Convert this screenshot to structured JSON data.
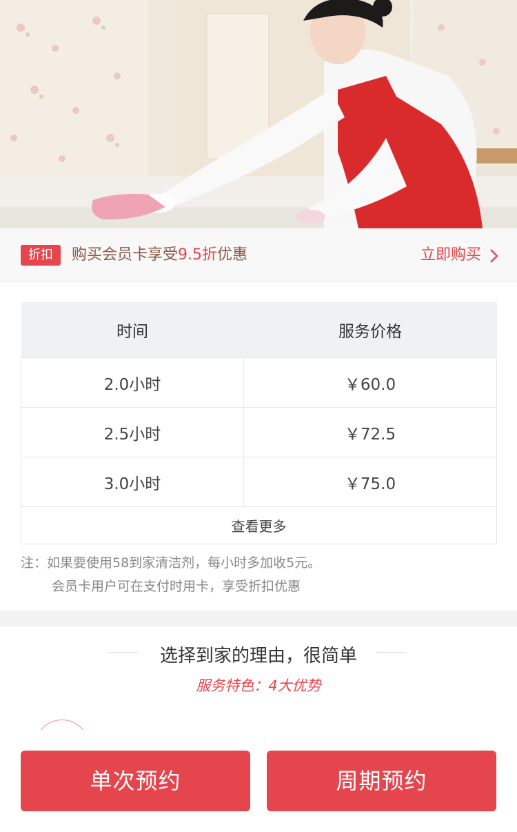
{
  "hero": {
    "image": "woman-cleaning-table-photo"
  },
  "promo": {
    "badge": "折扣",
    "text_before": "购买会员卡享受",
    "text_highlight": "9.5折",
    "text_after": "优惠",
    "link": "立即购买",
    "link_icon": "chevron-right-icon"
  },
  "price_table": {
    "headers": [
      "时间",
      "服务价格"
    ],
    "rows": [
      {
        "time": "2.0小时",
        "price": "￥60.0"
      },
      {
        "time": "2.5小时",
        "price": "￥72.5"
      },
      {
        "time": "3.0小时",
        "price": "￥75.0"
      }
    ],
    "more": "查看更多"
  },
  "note": {
    "line1": "注：如果要使用58到家清洁剂，每小时多加收5元。",
    "line2": "会员卡用户可在支付时用卡，享受折扣优惠"
  },
  "reasons": {
    "title": "选择到家的理由，很简单",
    "subtitle": "服务特色：4大优势"
  },
  "actions": {
    "single": "单次预约",
    "cycle": "周期预约"
  },
  "colors": {
    "accent": "#e5454d",
    "promo_text": "#8a5a44",
    "header_bg": "#f0f1f5"
  }
}
